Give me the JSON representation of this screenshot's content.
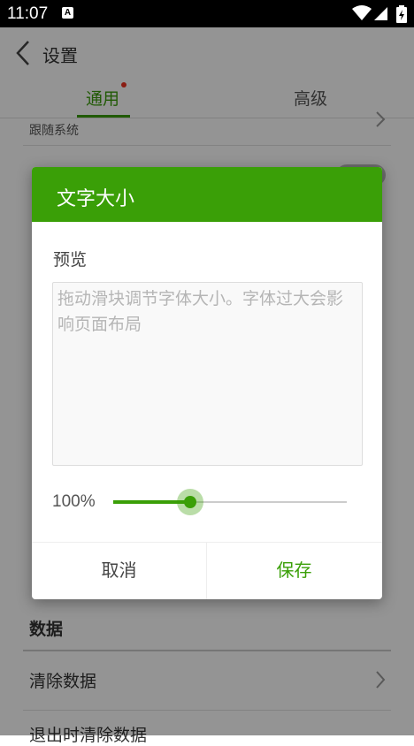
{
  "status_bar": {
    "time": "11:07",
    "notif_letter": "A"
  },
  "app_bar": {
    "title": "设置",
    "back_icon": "chevron-left-icon"
  },
  "tabs": [
    {
      "label": "通用"
    },
    {
      "label": "高级"
    }
  ],
  "background": {
    "follow_system": "跟随系统",
    "section_data": "数据",
    "clear_data": "清除数据",
    "clear_on_exit": "退出时清除数据"
  },
  "dialog": {
    "title": "文字大小",
    "preview_label": "预览",
    "preview_text": "拖动滑块调节字体大小。字体过大会影响页面布局",
    "percent_label": "100%",
    "slider_fraction": 0.33,
    "cancel_label": "取消",
    "save_label": "保存"
  },
  "colors": {
    "accent": "#3a9f07",
    "scrim": "rgba(0,0,0,0.42)"
  }
}
